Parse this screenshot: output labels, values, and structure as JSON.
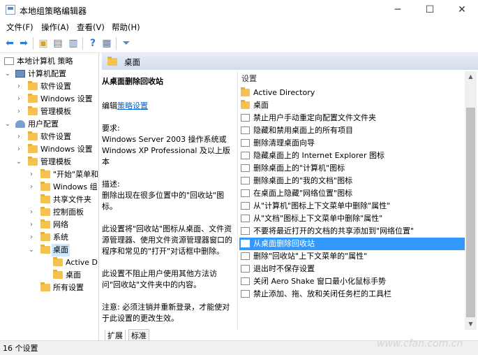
{
  "window": {
    "title": "本地组策略编辑器",
    "controls": [
      "─",
      "☐",
      "✕"
    ]
  },
  "menu": [
    "文件(F)",
    "操作(A)",
    "查看(V)",
    "帮助(H)"
  ],
  "tree": [
    {
      "label": "本地计算机 策略"
    },
    {
      "label": "计算机配置"
    },
    {
      "label": "软件设置"
    },
    {
      "label": "Windows 设置"
    },
    {
      "label": "管理模板"
    },
    {
      "label": "用户配置"
    },
    {
      "label": "软件设置"
    },
    {
      "label": "Windows 设置"
    },
    {
      "label": "管理模板"
    },
    {
      "label": "\"开始\"菜单和"
    },
    {
      "label": "Windows 组"
    },
    {
      "label": "共享文件夹"
    },
    {
      "label": "控制面板"
    },
    {
      "label": "网络"
    },
    {
      "label": "系统"
    },
    {
      "label": "桌面"
    },
    {
      "label": "Active Di"
    },
    {
      "label": "桌面"
    },
    {
      "label": "所有设置"
    }
  ],
  "header": {
    "title": "桌面"
  },
  "description": {
    "title": "从桌面删除回收站",
    "edit_prefix": "编辑",
    "edit_link": "策略设置",
    "req_label": "要求:",
    "req_text": "Windows Server 2003 操作系统或 Windows XP Professional 及以上版本",
    "desc_label": "描述:",
    "desc_text": "删除出现在很多位置中的\"回收站\"图标。",
    "p1": "此设置将\"回收站\"图标从桌面、文件资源管理器、使用文件资源管理器窗口的程序和常见的\"打开\"对话框中删除。",
    "p2": "此设置不阻止用户使用其他方法访问\"回收站\"文件夹中的内容。",
    "p3": "注意: 必须注销并重新登录，才能使对于此设置的更改生效。"
  },
  "list": {
    "column": "设置",
    "items": [
      {
        "label": "Active Directory",
        "icon": "folder"
      },
      {
        "label": "桌面",
        "icon": "folder"
      },
      {
        "label": "禁止用户手动重定向配置文件文件夹",
        "icon": "policy"
      },
      {
        "label": "隐藏和禁用桌面上的所有项目",
        "icon": "policy"
      },
      {
        "label": "删除清理桌面向导",
        "icon": "policy"
      },
      {
        "label": "隐藏桌面上的 Internet Explorer 图标",
        "icon": "policy"
      },
      {
        "label": "删除桌面上的\"计算机\"图标",
        "icon": "policy"
      },
      {
        "label": "删除桌面上的\"我的文档\"图标",
        "icon": "policy"
      },
      {
        "label": "在桌面上隐藏\"网络位置\"图标",
        "icon": "policy"
      },
      {
        "label": "从\"计算机\"图标上下文菜单中删除\"属性\"",
        "icon": "policy"
      },
      {
        "label": "从\"文档\"图标上下文菜单中删除\"属性\"",
        "icon": "policy"
      },
      {
        "label": "不要将最近打开的文档的共享添加到\"网络位置\"",
        "icon": "policy"
      },
      {
        "label": "从桌面删除回收站",
        "icon": "policy",
        "selected": true
      },
      {
        "label": "删除\"回收站\"上下文菜单的\"属性\"",
        "icon": "policy"
      },
      {
        "label": "退出时不保存设置",
        "icon": "policy"
      },
      {
        "label": "关闭 Aero Shake 窗口最小化鼠标手势",
        "icon": "policy"
      },
      {
        "label": "禁止添加、拖、放和关闭任务栏的工具栏",
        "icon": "policy"
      }
    ]
  },
  "tabs": [
    "扩展",
    "标准"
  ],
  "status": "16 个设置",
  "watermark": "www.cfan.com.cn"
}
